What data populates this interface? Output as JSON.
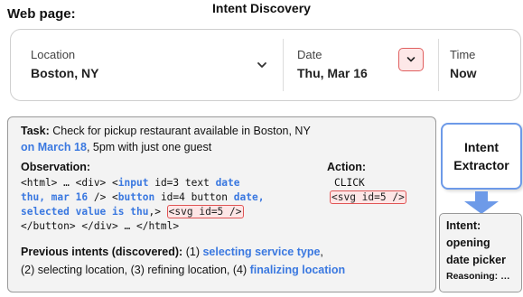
{
  "header": {
    "section_label": "Web page:",
    "diagram_title": "Intent Discovery"
  },
  "widget": {
    "location_label": "Location",
    "location_value": "Boston, NY",
    "date_label": "Date",
    "date_value": "Thu, Mar 16",
    "time_label": "Time",
    "time_value": "Now"
  },
  "task": {
    "task_label": "Task:",
    "task_text_1": "Check for pickup restaurant available in Boston, NY",
    "task_date": "on March 18",
    "task_text_2": ", 5pm with just one guest"
  },
  "observation": {
    "label": "Observation:",
    "line1_a": "<html> … <div> <",
    "line1_input": "input",
    "line1_b": " id=3 text ",
    "line1_date": "date",
    "line2_a": "thu, mar 16",
    "line2_b": " /> <",
    "line2_button": "button",
    "line2_c": " id=4 button ",
    "line2_date": "date,",
    "line3_a": "selected value is thu",
    "line3_b": ",> ",
    "line3_svg": "<svg id=5 />",
    "line4": "</button> </div> … </html>"
  },
  "action": {
    "label": "Action:",
    "verb": "CLICK",
    "target": "<svg id=5 />"
  },
  "previous": {
    "label": "Previous intents (discovered):",
    "item1_num": "(1)",
    "item1": "selecting service type",
    "item1_tail": ",",
    "line2_a": "(2) selecting location, (3) refining location, (4)",
    "item4": "finalizing location"
  },
  "extractor": {
    "line1": "Intent",
    "line2": "Extractor"
  },
  "intent_output": {
    "label": "Intent:",
    "line1": "opening",
    "line2": "date picker",
    "reasoning": "Reasoning: …"
  },
  "colors": {
    "accent_blue": "#3a78e0",
    "highlight_red": "#e05555",
    "extractor_border": "#6d9ae8",
    "arrow_blue": "#6d9ae8"
  },
  "icons": [
    "chevron-down-icon",
    "chevron-down-icon",
    "down-arrow-icon"
  ]
}
